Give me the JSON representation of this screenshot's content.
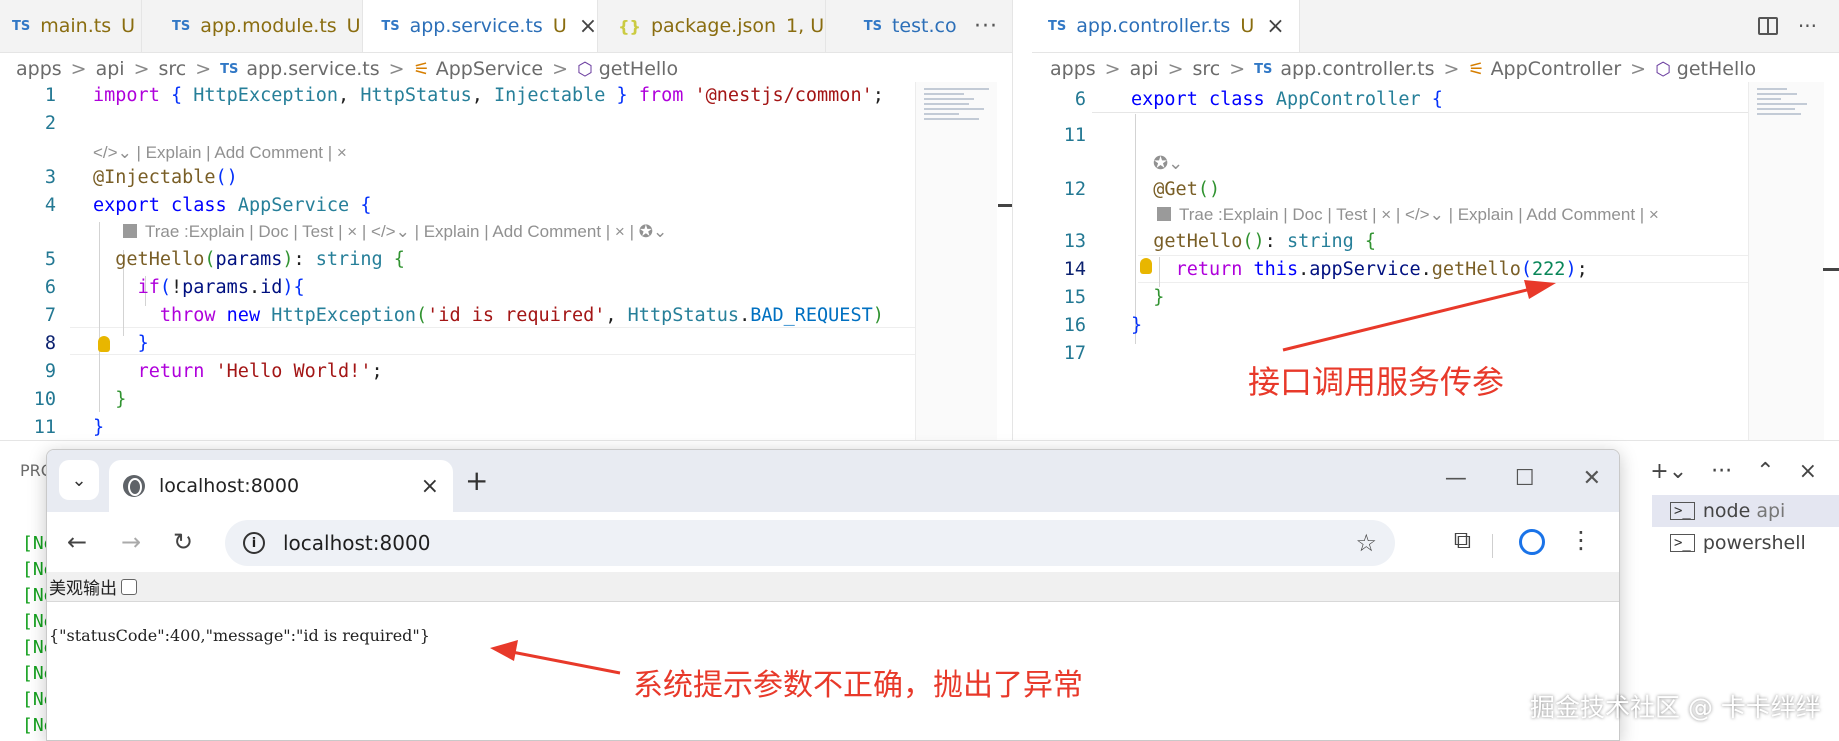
{
  "left_editor": {
    "tabs": [
      {
        "badge": "TS",
        "name": "main.ts",
        "status": "U",
        "active": false
      },
      {
        "badge": "TS",
        "name": "app.module.ts",
        "status": "U",
        "active": false
      },
      {
        "badge": "TS",
        "name": "app.service.ts",
        "status": "U",
        "active": true
      },
      {
        "badge": "{}",
        "name": "package.json",
        "status": "1, U",
        "active": false
      },
      {
        "badge": "TS",
        "name": "test.co",
        "status": "",
        "active": false
      }
    ],
    "tab_more": "···",
    "breadcrumb": [
      "apps",
      "api",
      "src",
      "app.service.ts",
      "AppService",
      "getHello"
    ],
    "code_lens_1": "| Explain | Add Comment |",
    "code_lens_2": "Trae :Explain | Doc | Test | × |",
    "code_lens_3": "| Explain | Add Comment |",
    "line_numbers": [
      "1",
      "2",
      "3",
      "4",
      "5",
      "6",
      "7",
      "8",
      "9",
      "10",
      "11"
    ]
  },
  "right_editor": {
    "tab": {
      "badge": "TS",
      "name": "app.controller.ts",
      "status": "U"
    },
    "actions": [
      "split-editor",
      "more"
    ],
    "breadcrumb": [
      "apps",
      "api",
      "src",
      "app.controller.ts",
      "AppController",
      "getHello"
    ],
    "code_lens": "Trae :Explain | Doc | Test | × |",
    "code_lens_2": "| Explain | Add Comment |",
    "line_numbers": [
      "6",
      "11",
      "12",
      "13",
      "14",
      "15",
      "16",
      "17"
    ],
    "annotation": "接口调用服务传参"
  },
  "panel": {
    "label": "PRO",
    "terminal_prefix": "[Ne",
    "terminals": [
      {
        "name": "node",
        "detail": "api",
        "selected": true
      },
      {
        "name": "powershell",
        "detail": "",
        "selected": false
      }
    ]
  },
  "browser": {
    "tab_title": "localhost:8000",
    "url": "localhost:8000",
    "pretty_print_label": "美观输出",
    "response_body": "{\"statusCode\":400,\"message\":\"id is required\"}",
    "annotation": "系统提示参数不正确，抛出了异常"
  },
  "watermark": "掘金技术社区 @ 卡卡绊绊",
  "colors": {
    "annotation": "#e8392a",
    "arrow": "#e8392a",
    "terminal_text": "#14a01e",
    "ts_badge": "#3178c6"
  }
}
